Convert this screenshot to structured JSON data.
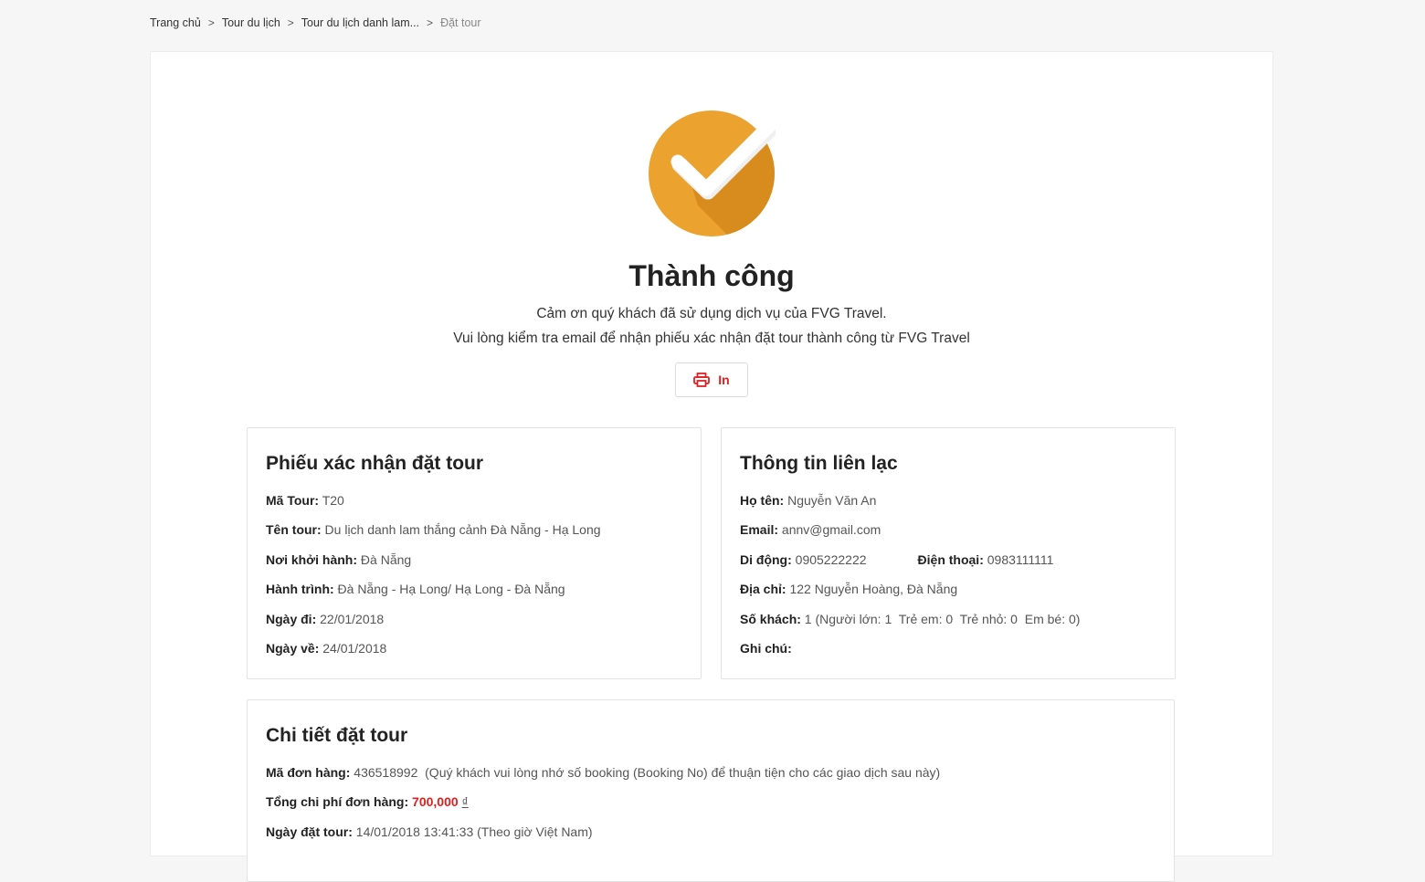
{
  "breadcrumb": [
    {
      "label": "Trang chủ"
    },
    {
      "label": "Tour du lịch"
    },
    {
      "label": "Tour du lịch danh lam..."
    },
    {
      "label": "Đặt tour"
    }
  ],
  "success": {
    "title": "Thành công",
    "message_line1": "Cảm ơn quý khách đã sử dụng dịch vụ của FVG Travel.",
    "message_line2": "Vui lòng kiểm tra email để nhận phiếu xác nhận đặt tour thành công từ FVG Travel",
    "print_label": "In",
    "icon_color": "#EBA22F",
    "accent_color": "#E02020"
  },
  "booking": {
    "title": "Phiếu xác nhận đặt tour",
    "rows": [
      {
        "label": "Mã Tour:",
        "value": "T20"
      },
      {
        "label": "Tên tour:",
        "value": "Du lịch danh lam thắng cảnh Đà Nẵng - Hạ Long"
      },
      {
        "label": "Nơi khởi hành:",
        "value": "Đà Nẵng"
      },
      {
        "label": "Hành trình:",
        "value": "Đà Nẵng - Hạ Long/ Hạ Long - Đà Nẵng"
      },
      {
        "label": "Ngày đi:",
        "value": "22/01/2018"
      },
      {
        "label": "Ngày về:",
        "value": "24/01/2018"
      }
    ]
  },
  "contact": {
    "title": "Thông tin liên lạc",
    "name_label": "Họ tên:",
    "name_value": "Nguyễn Văn An",
    "email_label": "Email:",
    "email_value": "annv@gmail.com",
    "mobile_label": "Di động:",
    "mobile_value": "0905222222",
    "phone_label": "Điện thoại:",
    "phone_value": "0983111111",
    "address_label": "Địa chỉ:",
    "address_value": "122 Nguyễn Hoàng, Đà Nẵng",
    "guests_label": "Số khách:",
    "guests_value": "1 (Người lớn: 1  Trẻ em: 0  Trẻ nhỏ: 0  Em bé: 0)",
    "note_label": "Ghi chú:",
    "note_value": ""
  },
  "details": {
    "title": "Chi tiết đặt tour",
    "order_label": "Mã đơn hàng:",
    "order_value": "436518992  (Quý khách vui lòng nhớ số booking (Booking No) để thuận tiện cho các giao dịch sau này)",
    "total_label": "Tổng chi phí đơn hàng:",
    "total_value": "700,000",
    "currency": "₫",
    "date_label": "Ngày đặt tour:",
    "date_value": "14/01/2018 13:41:33 (Theo giờ Việt Nam)"
  }
}
